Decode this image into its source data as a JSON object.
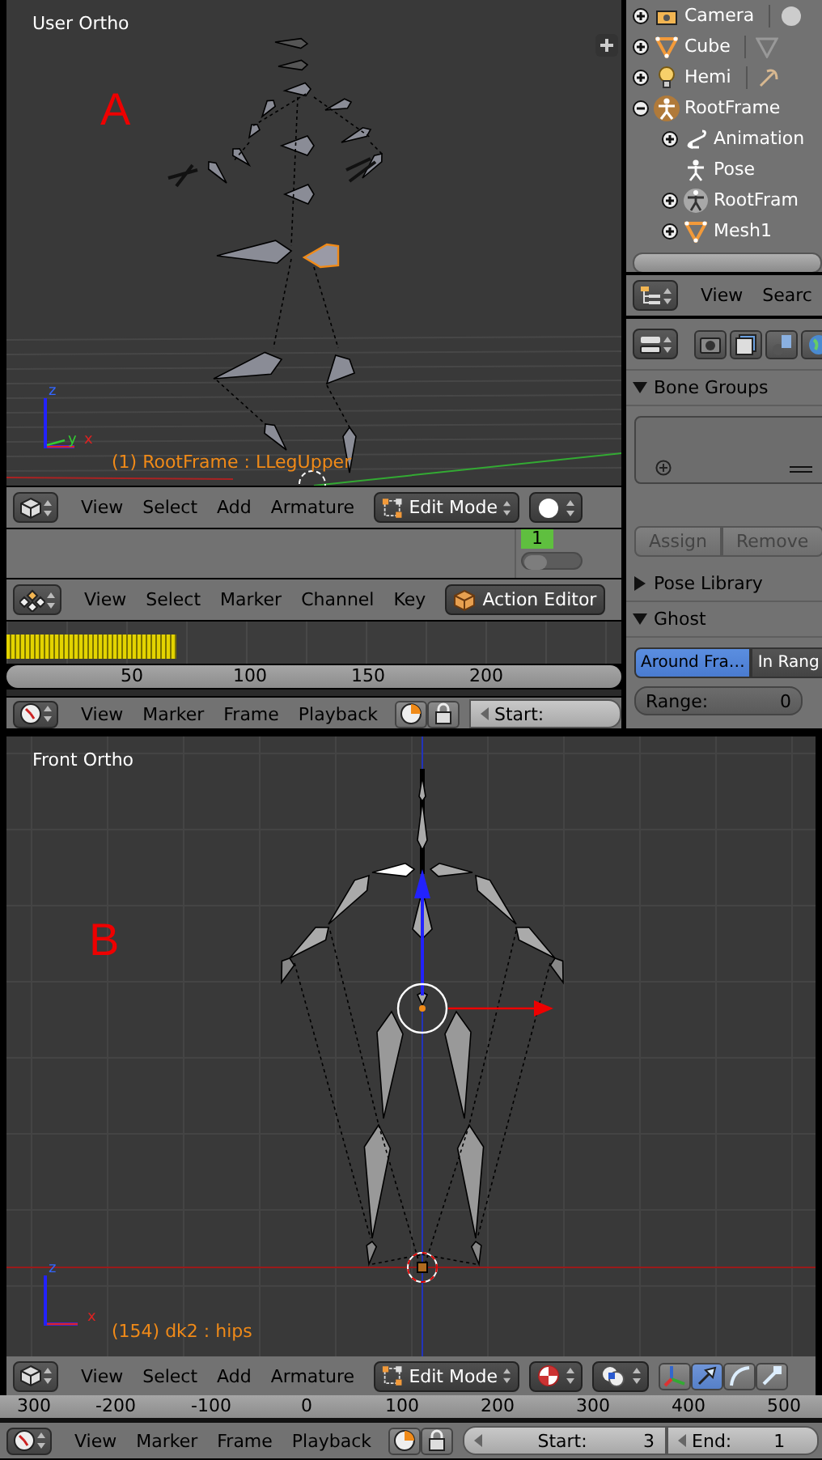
{
  "viewport_a": {
    "title": "User Ortho",
    "label": "A",
    "status": "(1) RootFrame : LLegUpper",
    "axes": [
      "z",
      "y",
      "x"
    ]
  },
  "header_a": {
    "menus": [
      "View",
      "Select",
      "Add",
      "Armature"
    ],
    "mode": "Edit Mode"
  },
  "action_area": {
    "current_frame": "1",
    "toggle_on": false
  },
  "action_header": {
    "menus": [
      "View",
      "Select",
      "Marker",
      "Channel",
      "Key"
    ],
    "editor": "Action Editor"
  },
  "action_ruler": {
    "ticks": [
      "50",
      "100",
      "150",
      "200"
    ]
  },
  "timeline_a": {
    "menus": [
      "View",
      "Marker",
      "Frame",
      "Playback"
    ],
    "start_label": "Start:"
  },
  "outliner": {
    "items": [
      {
        "label": "Camera",
        "kind": "camera",
        "expanded": false,
        "active": false
      },
      {
        "label": "Cube",
        "kind": "mesh",
        "expanded": false,
        "active": false
      },
      {
        "label": "Hemi",
        "kind": "lamp",
        "expanded": false,
        "active": false
      },
      {
        "label": "RootFrame",
        "kind": "armature",
        "expanded": true,
        "active": true,
        "children": [
          {
            "label": "Animation",
            "kind": "animation",
            "expanded": false,
            "active": false
          },
          {
            "label": "Pose",
            "kind": "pose",
            "active": false
          },
          {
            "label": "RootFram",
            "kind": "armature-data",
            "expanded": false,
            "active": false
          },
          {
            "label": "Mesh1",
            "kind": "mesh",
            "expanded": false,
            "active": false
          }
        ]
      }
    ]
  },
  "outliner_header": {
    "menus": [
      "View",
      "Searc"
    ]
  },
  "properties": {
    "panels": [
      {
        "title": "Bone Groups",
        "kind": "bone-groups",
        "expanded": true,
        "buttons": [
          "Assign",
          "Remove"
        ]
      },
      {
        "title": "Pose Library",
        "expanded": false
      },
      {
        "title": "Ghost",
        "kind": "ghost",
        "expanded": true,
        "options": [
          {
            "label": "Around Fra…",
            "selected": true
          },
          {
            "label": "In Rang",
            "selected": false
          }
        ],
        "range_label": "Range:",
        "range_value": "0"
      }
    ]
  },
  "viewport_b": {
    "title": "Front Ortho",
    "label": "B",
    "status": "(154) dk2 : hips",
    "axes": [
      "z",
      "x"
    ]
  },
  "header_b": {
    "menus": [
      "View",
      "Select",
      "Add",
      "Armature"
    ],
    "mode": "Edit Mode",
    "manipulators": [
      {
        "kind": "axes",
        "selected": false
      },
      {
        "kind": "translate",
        "selected": true
      },
      {
        "kind": "rotate",
        "selected": false
      },
      {
        "kind": "scale",
        "selected": false
      }
    ]
  },
  "ruler_b": {
    "ticks": [
      "300",
      "-200",
      "-100",
      "0",
      "100",
      "200",
      "300",
      "400",
      "500"
    ]
  },
  "timeline_b": {
    "menus": [
      "View",
      "Marker",
      "Frame",
      "Playback"
    ],
    "start_label": "Start:",
    "start_value": "3",
    "end_label": "End:",
    "end_value": "1"
  }
}
